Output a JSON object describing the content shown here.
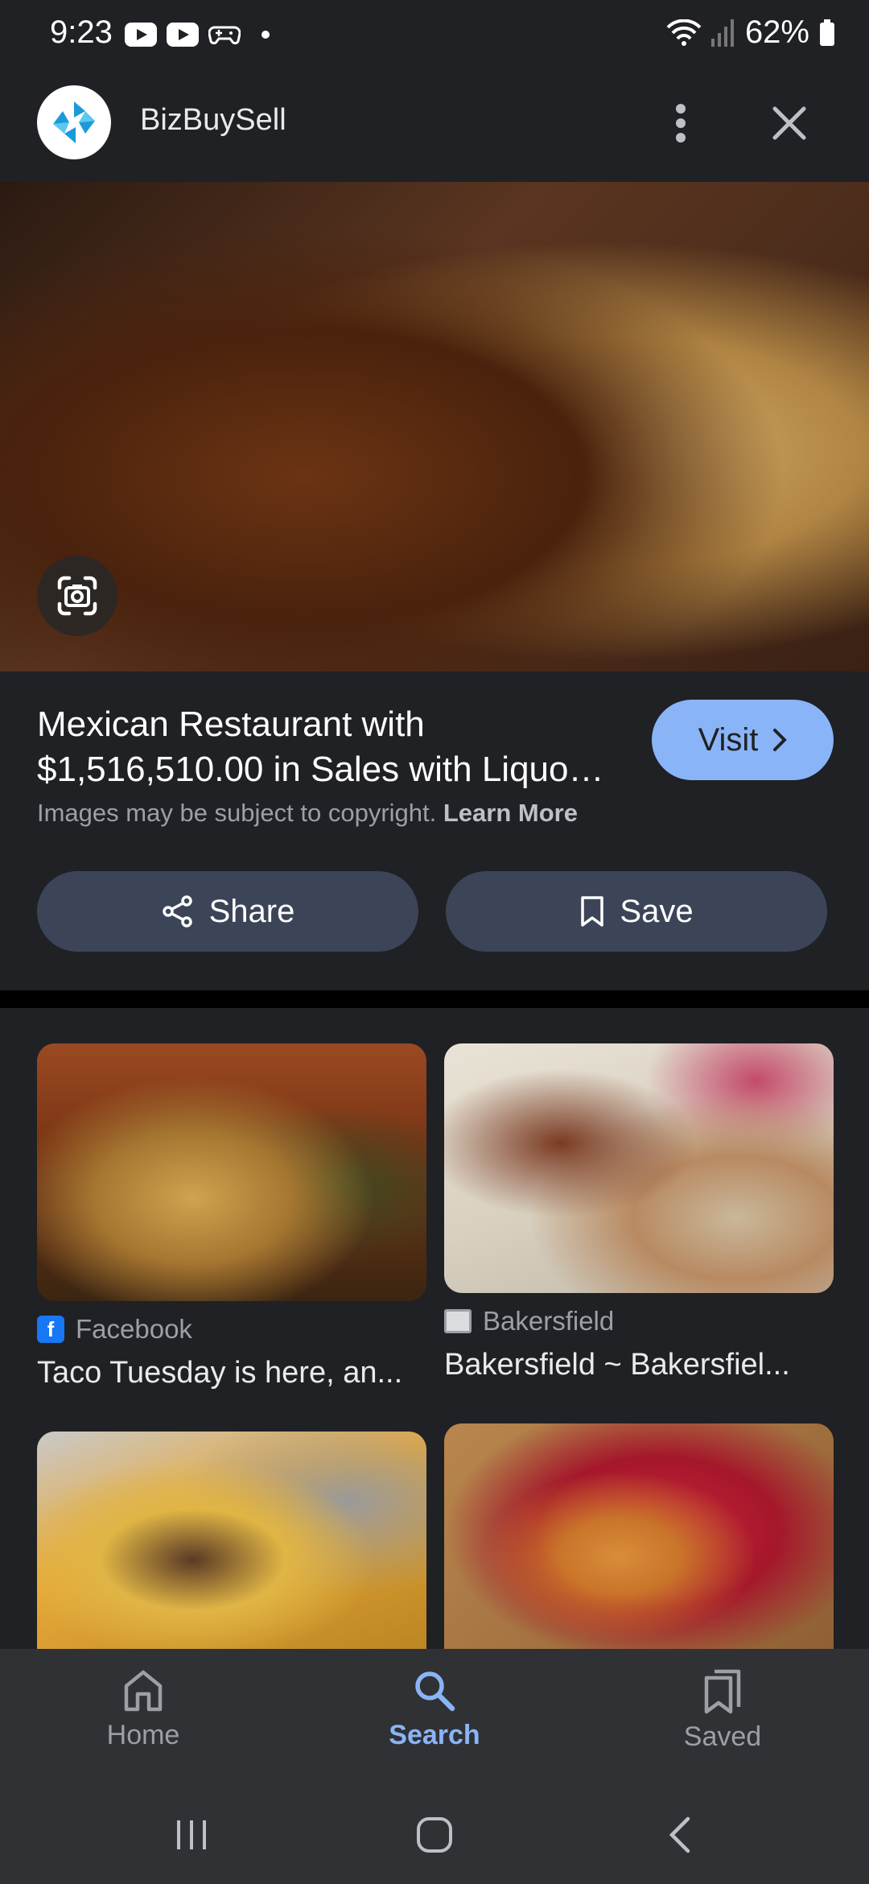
{
  "status_bar": {
    "time": "9:23",
    "battery": "62%"
  },
  "header": {
    "site_name": "BizBuySell"
  },
  "result": {
    "title_line1": "Mexican Restaurant with",
    "title_line2": "$1,516,510.00 in Sales with Liquo…",
    "copyright_text": "Images may be subject to copyright.",
    "learn_more": "Learn More",
    "visit_label": "Visit",
    "share_label": "Share",
    "save_label": "Save"
  },
  "related": [
    {
      "source": "Facebook",
      "caption": "Taco Tuesday is here, an..."
    },
    {
      "source": "Bakersfield",
      "caption": "Bakersfield ~ Bakersfiel..."
    }
  ],
  "bottom_nav": [
    {
      "label": "Home",
      "icon": "home-icon"
    },
    {
      "label": "Search",
      "icon": "search-icon"
    },
    {
      "label": "Saved",
      "icon": "saved-icon"
    }
  ],
  "colors": {
    "accent": "#8ab4f8",
    "background": "#202124",
    "pill": "#3c4557"
  }
}
